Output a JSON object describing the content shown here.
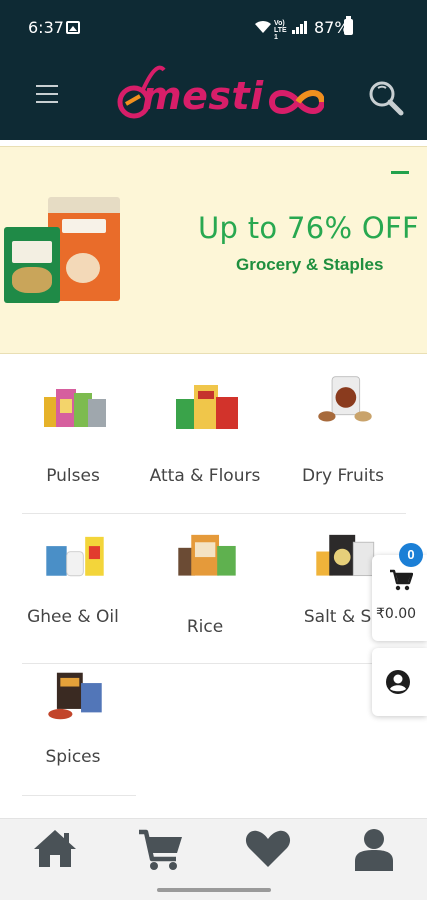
{
  "status_bar": {
    "time": "6:37",
    "network_label": "Vo) LTE1",
    "battery_percent": "87%"
  },
  "header": {
    "logo_text": "mesti",
    "menu_icon": "hamburger-menu-icon",
    "search_icon": "search-icon"
  },
  "banner": {
    "title": "Up to 76% OFF",
    "subtitle": "Grocery & Staples"
  },
  "categories": [
    {
      "label": "Pulses"
    },
    {
      "label": "Atta & Flours"
    },
    {
      "label": "Dry Fruits"
    },
    {
      "label": "Ghee & Oil"
    },
    {
      "label": "Rice"
    },
    {
      "label": "Salt & Su"
    },
    {
      "label": "Spices"
    }
  ],
  "cart": {
    "count": "0",
    "total": "₹0.00"
  },
  "bottom_nav": {
    "items": [
      "home-icon",
      "cart-icon",
      "heart-icon",
      "user-icon"
    ]
  },
  "colors": {
    "header_bg": "#0e2a34",
    "brand_pink": "#d71e69",
    "brand_orange": "#f0901e",
    "banner_bg": "#fdf6d7",
    "offer_green": "#28a850",
    "badge_blue": "#1b7fd6",
    "nav_icon": "#4a5257"
  }
}
